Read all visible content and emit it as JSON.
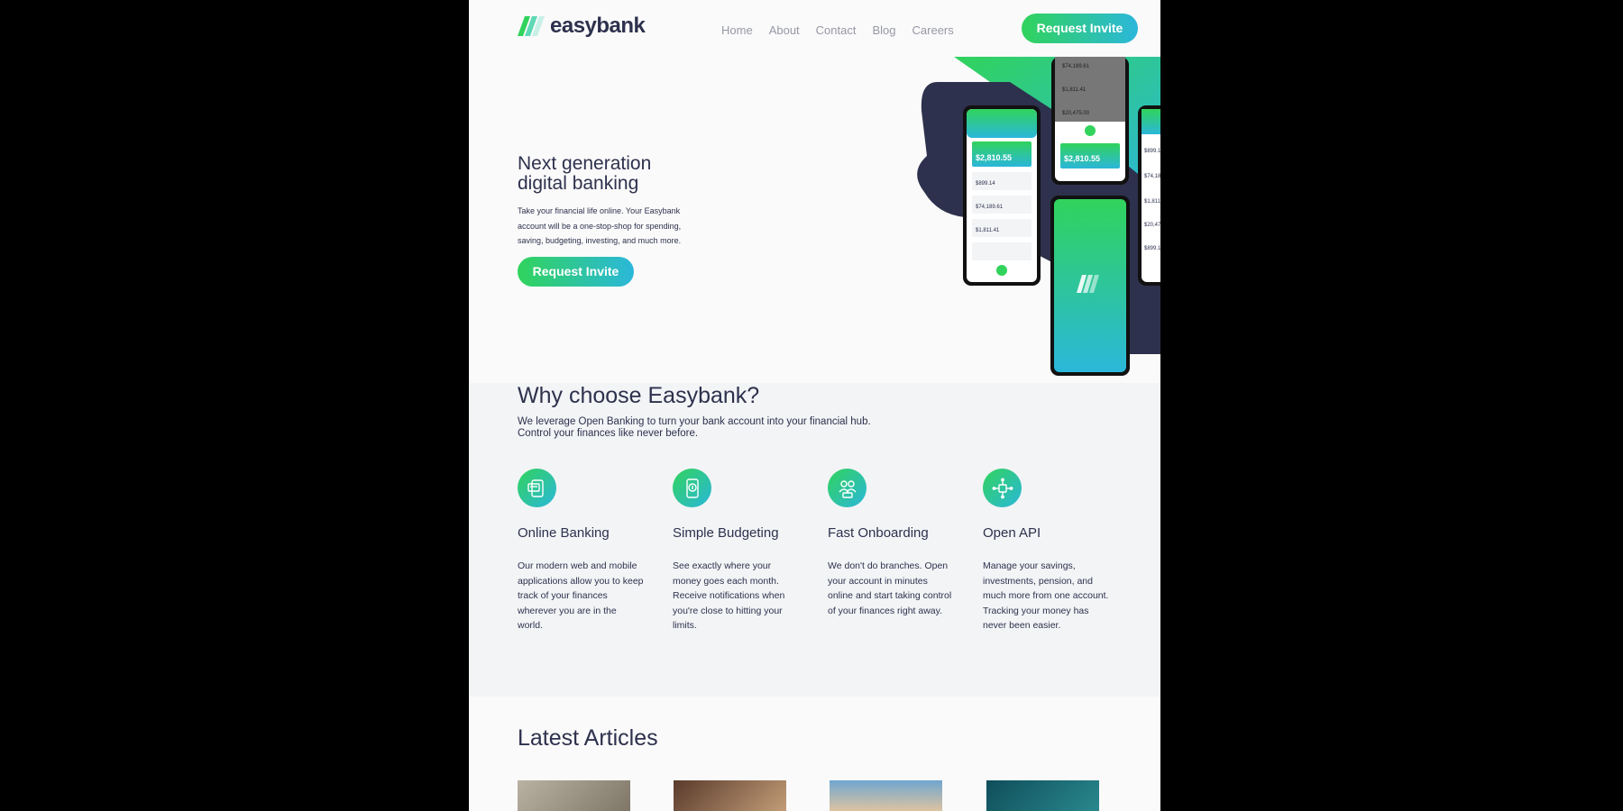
{
  "brand": {
    "name": "easybank",
    "colors": {
      "dark": "#2d314d",
      "green": "#31d35c",
      "cyan": "#2bb7da"
    }
  },
  "nav": {
    "items": [
      "Home",
      "About",
      "Contact",
      "Blog",
      "Careers"
    ]
  },
  "header": {
    "cta": "Request Invite"
  },
  "hero": {
    "title": "Next generation digital banking",
    "text": "Take your financial life online. Your Easybank account will be a one-stop-shop for spending, saving, budgeting, investing, and much more.",
    "cta": "Request Invite",
    "mockups": {
      "balance": "$2,810.55",
      "amounts": [
        "$899.14",
        "$74,189.61",
        "$1,811.41",
        "$20,475.00"
      ]
    }
  },
  "why": {
    "title": "Why choose Easybank?",
    "text": "We leverage Open Banking to turn your bank account into your financial hub. Control your finances like never before.",
    "features": [
      {
        "icon": "online-banking-icon",
        "title": "Online Banking",
        "desc": "Our modern web and mobile applications allow you to keep track of your finances wherever you are in the world."
      },
      {
        "icon": "budgeting-icon",
        "title": "Simple Budgeting",
        "desc": "See exactly where your money goes each month. Receive notifications when you're close to hitting your limits."
      },
      {
        "icon": "onboarding-icon",
        "title": "Fast Onboarding",
        "desc": "We don't do branches. Open your account in minutes online and start taking control of your finances right away."
      },
      {
        "icon": "api-icon",
        "title": "Open API",
        "desc": "Manage your savings, investments, pension, and much more from one account. Tracking your money has never been easier."
      }
    ]
  },
  "articles": {
    "title": "Latest Articles"
  }
}
